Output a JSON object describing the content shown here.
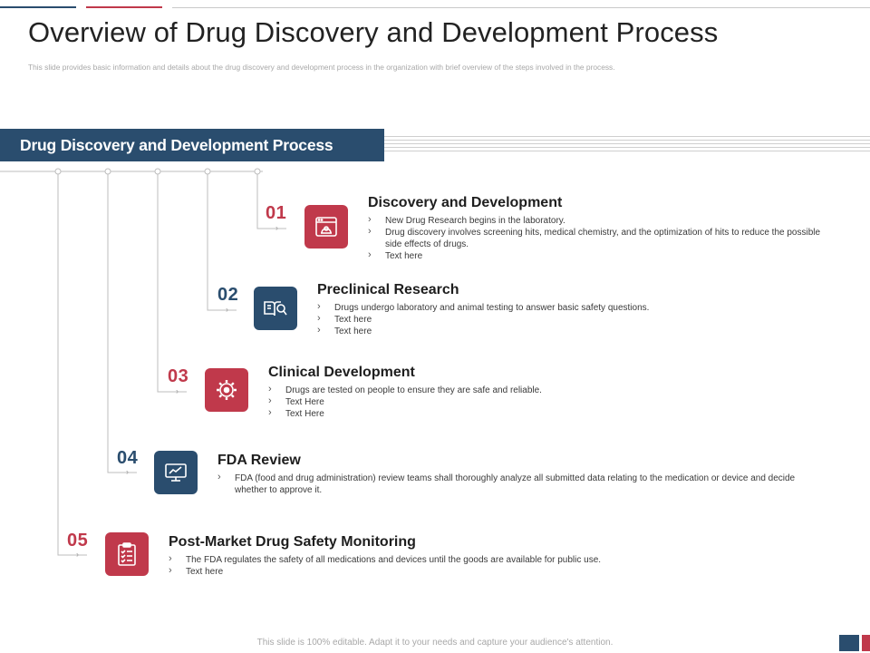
{
  "slide": {
    "title": "Overview of Drug Discovery and Development Process",
    "subtitle": "This slide provides basic information and details about the drug discovery and development process in the organization with brief overview of the steps involved in the process.",
    "banner": "Drug Discovery and Development Process",
    "footer": "This slide is 100% editable. Adapt it to your needs and capture your audience's attention."
  },
  "colors": {
    "accent_blue": "#2a4d6e",
    "accent_red": "#c0394b"
  },
  "steps": [
    {
      "number": "01",
      "heading": "Discovery and Development",
      "icon": "laboratory-window-icon",
      "color": "red",
      "bullets": [
        "New Drug Research begins in the laboratory.",
        "Drug discovery involves screening hits, medical chemistry, and the optimization of hits to reduce the possible side effects of drugs.",
        "Text here"
      ]
    },
    {
      "number": "02",
      "heading": "Preclinical Research",
      "icon": "book-magnifier-icon",
      "color": "blue",
      "bullets": [
        "Drugs undergo laboratory and animal testing to answer basic safety questions.",
        "Text here",
        "Text here"
      ]
    },
    {
      "number": "03",
      "heading": "Clinical Development",
      "icon": "gears-icon",
      "color": "red",
      "bullets": [
        "Drugs are tested on people to ensure they are safe and reliable.",
        "Text Here",
        "Text Here"
      ]
    },
    {
      "number": "04",
      "heading": "FDA Review",
      "icon": "monitor-chart-icon",
      "color": "blue",
      "bullets": [
        "FDA (food and drug administration) review teams shall thoroughly analyze all submitted data relating to the medication or device and decide whether to approve it."
      ]
    },
    {
      "number": "05",
      "heading": "Post-Market Drug Safety Monitoring",
      "icon": "clipboard-checklist-icon",
      "color": "red",
      "bullets": [
        "The FDA regulates the safety of all medications and devices until the goods are available for public use.",
        "Text here"
      ]
    }
  ]
}
